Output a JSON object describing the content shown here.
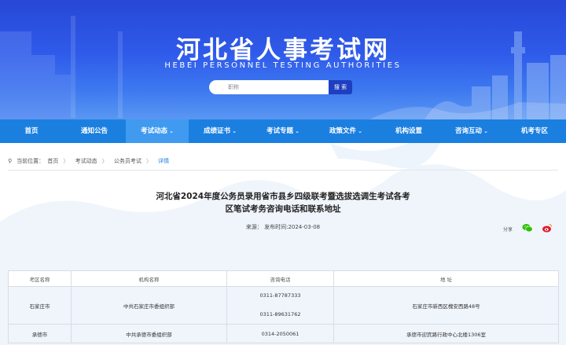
{
  "site": {
    "title": "河北省人事考试网",
    "subtitle": "HEBEI PERSONNEL TESTING AUTHORITIES"
  },
  "search": {
    "placeholder": "职称",
    "button_label": "搜 索"
  },
  "nav": {
    "items": [
      {
        "label": "首页"
      },
      {
        "label": "通知公告"
      },
      {
        "label": "考试动态",
        "has_dropdown": true
      },
      {
        "label": "成绩证书",
        "has_dropdown": true
      },
      {
        "label": "考试专题",
        "has_dropdown": true
      },
      {
        "label": "政策文件",
        "has_dropdown": true
      },
      {
        "label": "机构设置"
      },
      {
        "label": "咨询互动",
        "has_dropdown": true
      },
      {
        "label": "机考专区"
      }
    ],
    "chevron": "⌄"
  },
  "breadcrumb": {
    "prefix": "当前位置：",
    "items": [
      "首页",
      "考试动态",
      "公务员考试",
      "详情"
    ],
    "separator": "〉"
  },
  "article": {
    "title_line1": "河北省2024年度公务员录用省市县乡四级联考暨选拔选调生考试各考",
    "title_line2": "区笔试考务咨询电话和联系地址",
    "meta": "来源：  发布时间:2024-03-08",
    "share_label": "分享"
  },
  "table": {
    "headers": [
      "考区名称",
      "机构名称",
      "咨询电话",
      "地  址"
    ],
    "rows": [
      {
        "area": "石家庄市",
        "org": "中共石家庄市委组织部",
        "phones": [
          "0311-87787333",
          "0311-89631762"
        ],
        "address": "石家庄市新西区槐安西路48号"
      },
      {
        "area": "承德市",
        "org": "中共承德市委组织部",
        "phones": [
          "0314-2050061"
        ],
        "address": "承德市迎宾路行政中心北楼1306室"
      }
    ]
  },
  "colors": {
    "banner_top": "#2747d6",
    "nav_bg": "#1b7fe0",
    "nav_active": "#3f9af0",
    "accent": "#1b7fe0",
    "wechat": "#2dc100",
    "weibo": "#e6162d"
  },
  "icons": {
    "location": "location-pin-icon",
    "search": "search-icon",
    "share_wechat": "wechat-icon",
    "share_weibo": "weibo-icon"
  }
}
